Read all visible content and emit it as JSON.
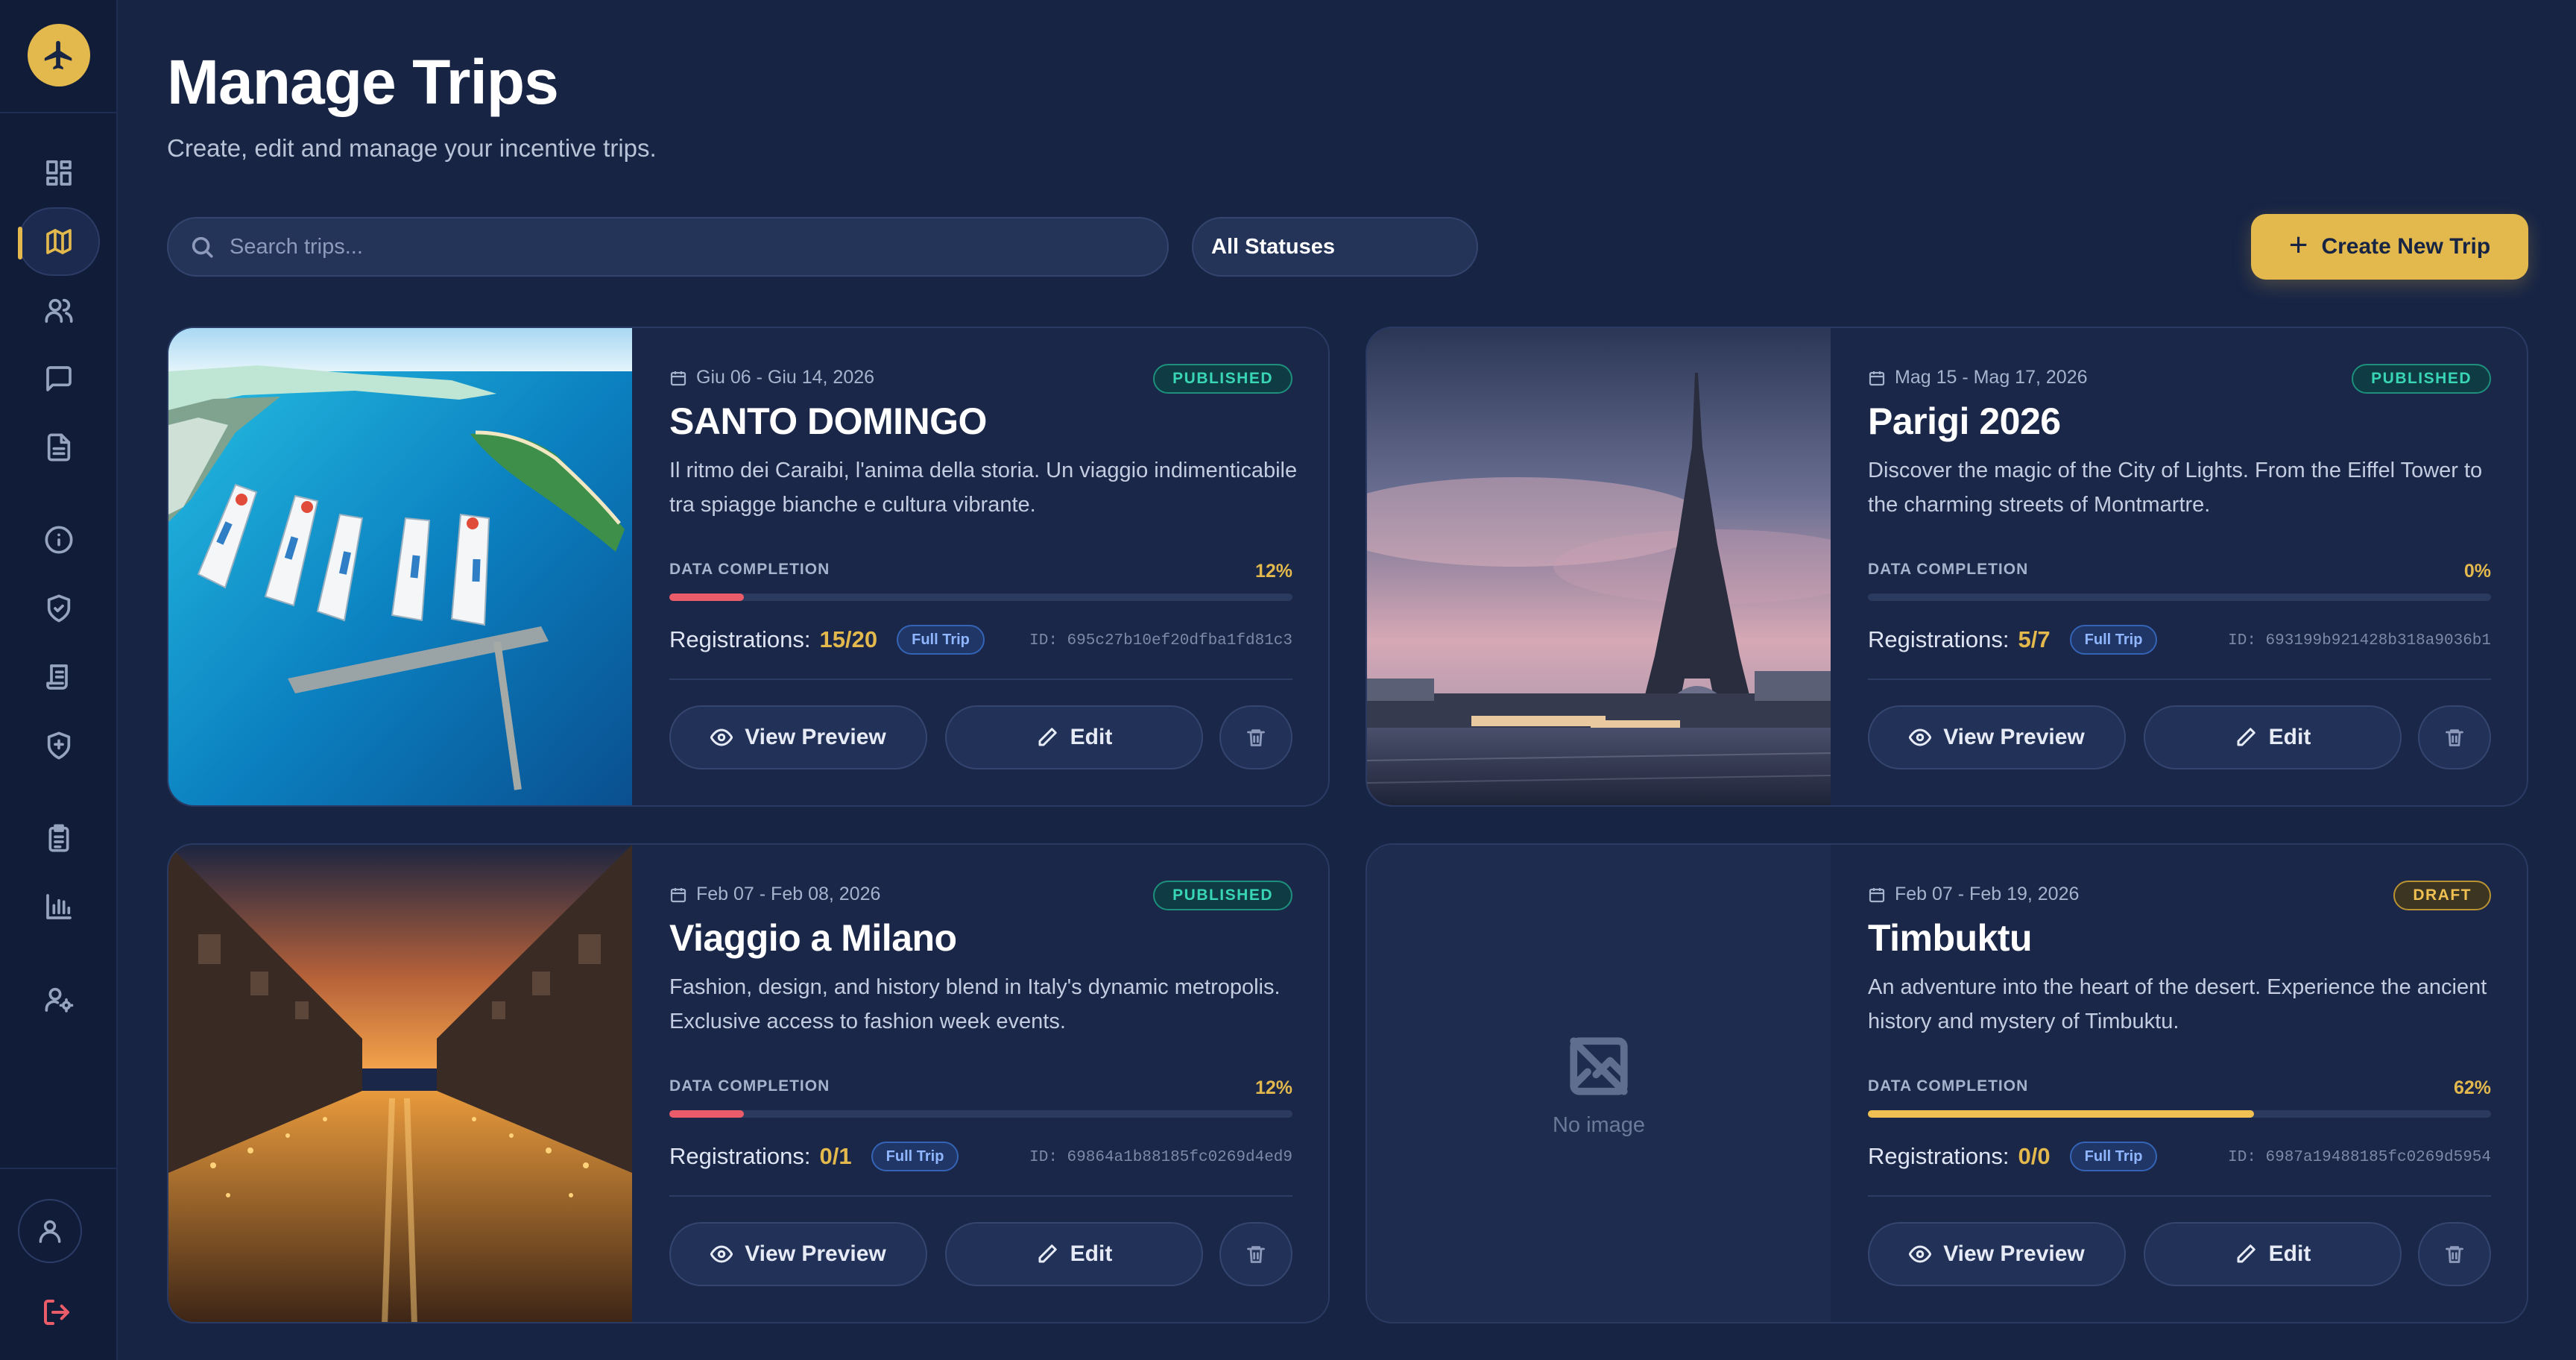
{
  "header": {
    "title": "Manage Trips",
    "subtitle": "Create, edit and manage your incentive trips."
  },
  "toolbar": {
    "search_placeholder": "Search trips...",
    "status_filter": "All Statuses",
    "create_label": "Create New Trip"
  },
  "sidebar": {
    "items": [
      {
        "icon": "dashboard-icon"
      },
      {
        "icon": "map-icon",
        "active": true
      },
      {
        "icon": "users-icon"
      },
      {
        "icon": "chat-icon"
      },
      {
        "icon": "document-icon"
      },
      {
        "icon": "info-icon"
      },
      {
        "icon": "shield-check-icon"
      },
      {
        "icon": "receipt-icon"
      },
      {
        "icon": "shield-plus-icon"
      },
      {
        "icon": "clipboard-icon"
      },
      {
        "icon": "chart-icon"
      },
      {
        "icon": "user-settings-icon"
      }
    ]
  },
  "labels": {
    "data_completion": "DATA COMPLETION",
    "registrations": "Registrations:",
    "view_preview": "View Preview",
    "edit": "Edit",
    "no_image": "No image"
  },
  "trips": [
    {
      "dates": "Giu 06 - Giu 14, 2026",
      "status": "PUBLISHED",
      "title": "SANTO DOMINGO",
      "description": "Il ritmo dei Caraibi, l'anima della storia. Un viaggio indimenticabile tra spiagge bianche e cultura vibrante.",
      "completion": "12%",
      "completion_value": 0.12,
      "completion_color": "#ea5c6a",
      "registrations": "15/20",
      "tag": "Full Trip",
      "id": "ID: 695c27b10ef20dfba1fd81c3"
    },
    {
      "dates": "Mag 15 - Mag 17, 2026",
      "status": "PUBLISHED",
      "title": "Parigi 2026",
      "description": "Discover the magic of the City of Lights. From the Eiffel Tower to the charming streets of Montmartre.",
      "completion": "0%",
      "completion_value": 0,
      "completion_color": "#ea5c6a",
      "registrations": "5/7",
      "tag": "Full Trip",
      "id": "ID: 693199b921428b318a9036b1"
    },
    {
      "dates": "Feb 07 - Feb 08, 2026",
      "status": "PUBLISHED",
      "title": "Viaggio a Milano",
      "description": "Fashion, design, and history blend in Italy's dynamic metropolis. Exclusive access to fashion week events.",
      "completion": "12%",
      "completion_value": 0.12,
      "completion_color": "#ea5c6a",
      "registrations": "0/1",
      "tag": "Full Trip",
      "id": "ID: 69864a1b88185fc0269d4ed9"
    },
    {
      "dates": "Feb 07 - Feb 19, 2026",
      "status": "DRAFT",
      "title": "Timbuktu",
      "description": "An adventure into the heart of the desert. Experience the ancient history and mystery of Timbuktu.",
      "completion": "62%",
      "completion_value": 0.62,
      "completion_color": "#f0c152",
      "registrations": "0/0",
      "tag": "Full Trip",
      "id": "ID: 6987a19488185fc0269d5954"
    }
  ]
}
